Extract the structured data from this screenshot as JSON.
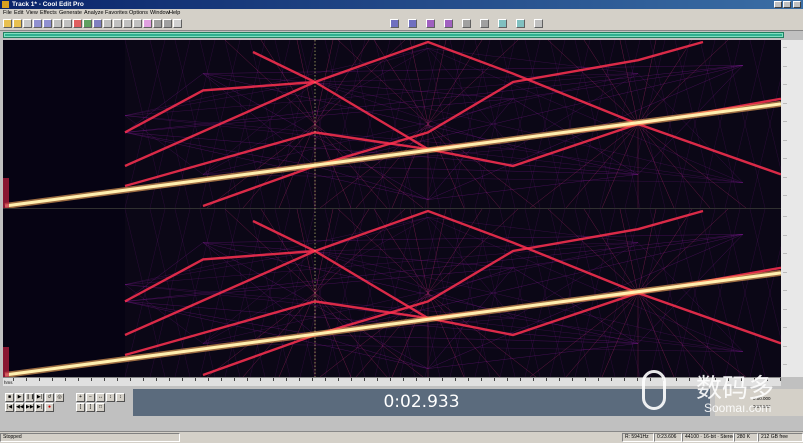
{
  "window": {
    "title": "Track 1* - Cool Edit Pro"
  },
  "menu": [
    "File",
    "Edit",
    "View",
    "Effects",
    "Generate",
    "Analyze",
    "Favorites",
    "Options",
    "Window",
    "Help"
  ],
  "time_display": "0:02.933",
  "time_ruler": {
    "left_label": "hms"
  },
  "selection_panel": {
    "row1": "0:00.000",
    "row2": "0:02.933"
  },
  "status": {
    "state": "Stopped",
    "cursor": "R: 5941Hz",
    "cursor_time": "0:23.606",
    "format": "44100 · 16-bit · Stereo",
    "size": "280 K",
    "free": "212 GB free"
  },
  "watermark": {
    "cn": "数码多",
    "en": "Soomaı.com"
  },
  "colors": {
    "spectrogram_bg": "#0b0716",
    "sweep": "#fff0b0",
    "harmonic": "#ff3050",
    "alias": "#8a1aa0"
  }
}
